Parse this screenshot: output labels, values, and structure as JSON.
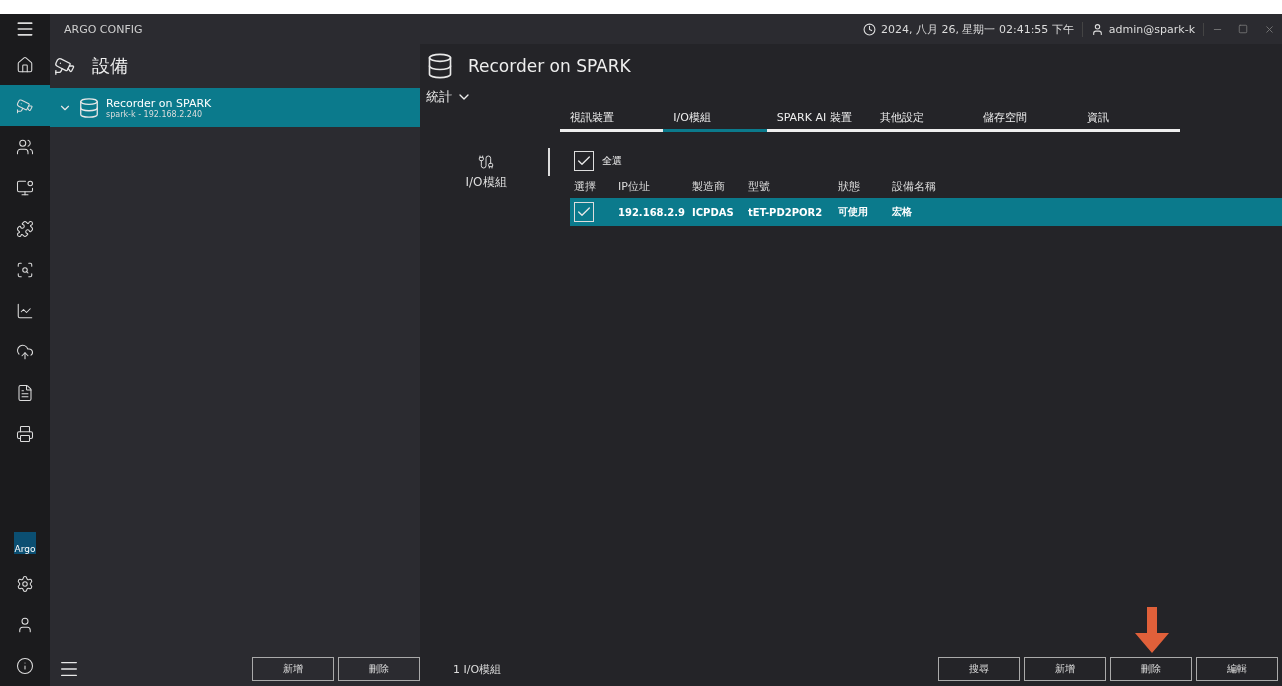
{
  "window": {
    "title": "ARGO CONFIG",
    "clock": "2024, 八月 26, 星期一 02:41:55 下午",
    "user": "admin@spark-k"
  },
  "rail": [
    {
      "kind": "home",
      "selected": false
    },
    {
      "kind": "camera",
      "selected": true
    },
    {
      "kind": "users",
      "selected": false
    },
    {
      "kind": "monitor",
      "selected": false
    },
    {
      "kind": "puzzle",
      "selected": false
    },
    {
      "kind": "scan",
      "selected": false
    },
    {
      "kind": "chart",
      "selected": false
    },
    {
      "kind": "cloud",
      "selected": false
    },
    {
      "kind": "file",
      "selected": false
    },
    {
      "kind": "printer",
      "selected": false
    },
    {
      "kind": "logo",
      "selected": false,
      "label": "Argo"
    },
    {
      "kind": "settings",
      "selected": false
    },
    {
      "kind": "user",
      "selected": false
    },
    {
      "kind": "info",
      "selected": false
    }
  ],
  "left_panel": {
    "heading": "設備",
    "tree": [
      {
        "title": "Recorder on SPARK",
        "subtitle": "spark-k - 192.168.2.240",
        "expanded": true,
        "selected": true
      }
    ],
    "buttons": [
      "新增",
      "刪除"
    ]
  },
  "main": {
    "device_title": "Recorder on SPARK",
    "dropdown": "統計",
    "tabs": [
      {
        "label": "視訊裝置",
        "selected": false
      },
      {
        "label": "I/O模組",
        "selected": true
      },
      {
        "label": "SPARK AI 裝置",
        "selected": false
      },
      {
        "label": "其他設定",
        "selected": false
      },
      {
        "label": "儲存空間",
        "selected": false
      },
      {
        "label": "資訊",
        "selected": false
      }
    ],
    "section_label": "I/O模組",
    "select_all": {
      "label": "全選",
      "checked": true
    },
    "table": {
      "columns": [
        "選擇",
        "IP位址",
        "製造商",
        "型號",
        "狀態",
        "設備名稱"
      ],
      "rows": [
        {
          "checked": true,
          "selected": true,
          "cells": [
            "",
            "192.168.2.9",
            "ICPDAS",
            "tET-PD2POR2",
            "可使用",
            "宏格"
          ]
        }
      ]
    },
    "count": "1 I/O模組",
    "buttons": [
      {
        "label": "搜尋",
        "marked": false
      },
      {
        "label": "新增",
        "marked": false
      },
      {
        "label": "刪除",
        "marked": true
      },
      {
        "label": "編輯",
        "marked": false
      }
    ]
  }
}
